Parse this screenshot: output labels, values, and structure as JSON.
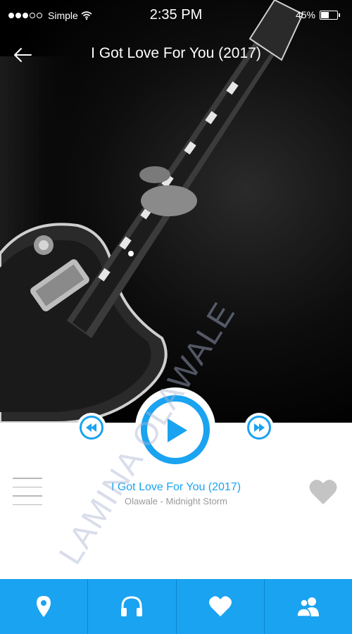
{
  "status_bar": {
    "carrier": "Simple",
    "time": "2:35 PM",
    "battery": "45%",
    "battery_level": 0.45
  },
  "header": {
    "title": "I Got Love For You (2017)"
  },
  "player": {
    "song_title": "I Got Love For You (2017)",
    "artist_album": "Olawale - Midnight Storm"
  },
  "watermark": "LAMINA OLAWALE",
  "tabs": [
    {
      "icon": "location-pin-icon"
    },
    {
      "icon": "headphones-icon"
    },
    {
      "icon": "heart-icon"
    },
    {
      "icon": "users-icon"
    }
  ],
  "colors": {
    "accent": "#1aa3f0",
    "tab_divider": "#0d87cf",
    "heart": "#c4c4c4",
    "subtitle": "#9a9a9a"
  }
}
